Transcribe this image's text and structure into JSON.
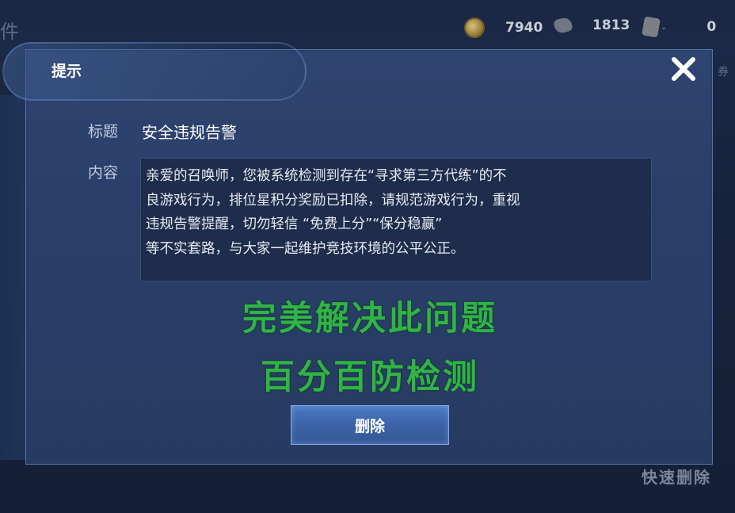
{
  "background": {
    "left_title_fragment": "件",
    "currencies": [
      {
        "icon": "gold-coin-icon",
        "value": "7940"
      },
      {
        "icon": "gem-icon",
        "value": "1813"
      },
      {
        "icon": "ticket-icon",
        "value": "0"
      }
    ],
    "right_label_fragment": "券",
    "quick_delete_label": "快速删除"
  },
  "modal": {
    "title": "提示",
    "close_icon": "close-icon",
    "subject_label": "标题",
    "subject_value": "安全违规告警",
    "content_label": "内容",
    "content_lines": [
      "亲爱的召唤师，您被系统检测到存在“寻求第三方代练”的不",
      "良游戏行为，排位星积分奖励已扣除，请规范游戏行为，重视",
      "违规告警提醒，切勿轻信 “免费上分”“保分稳赢”",
      "等不实套路，与大家一起维护竞技环境的公平公正。"
    ],
    "overlay_line1": "完美解决此问题",
    "overlay_line2": "百分百防检测",
    "overlay_color": "#2fb445",
    "delete_button_label": "删除"
  }
}
